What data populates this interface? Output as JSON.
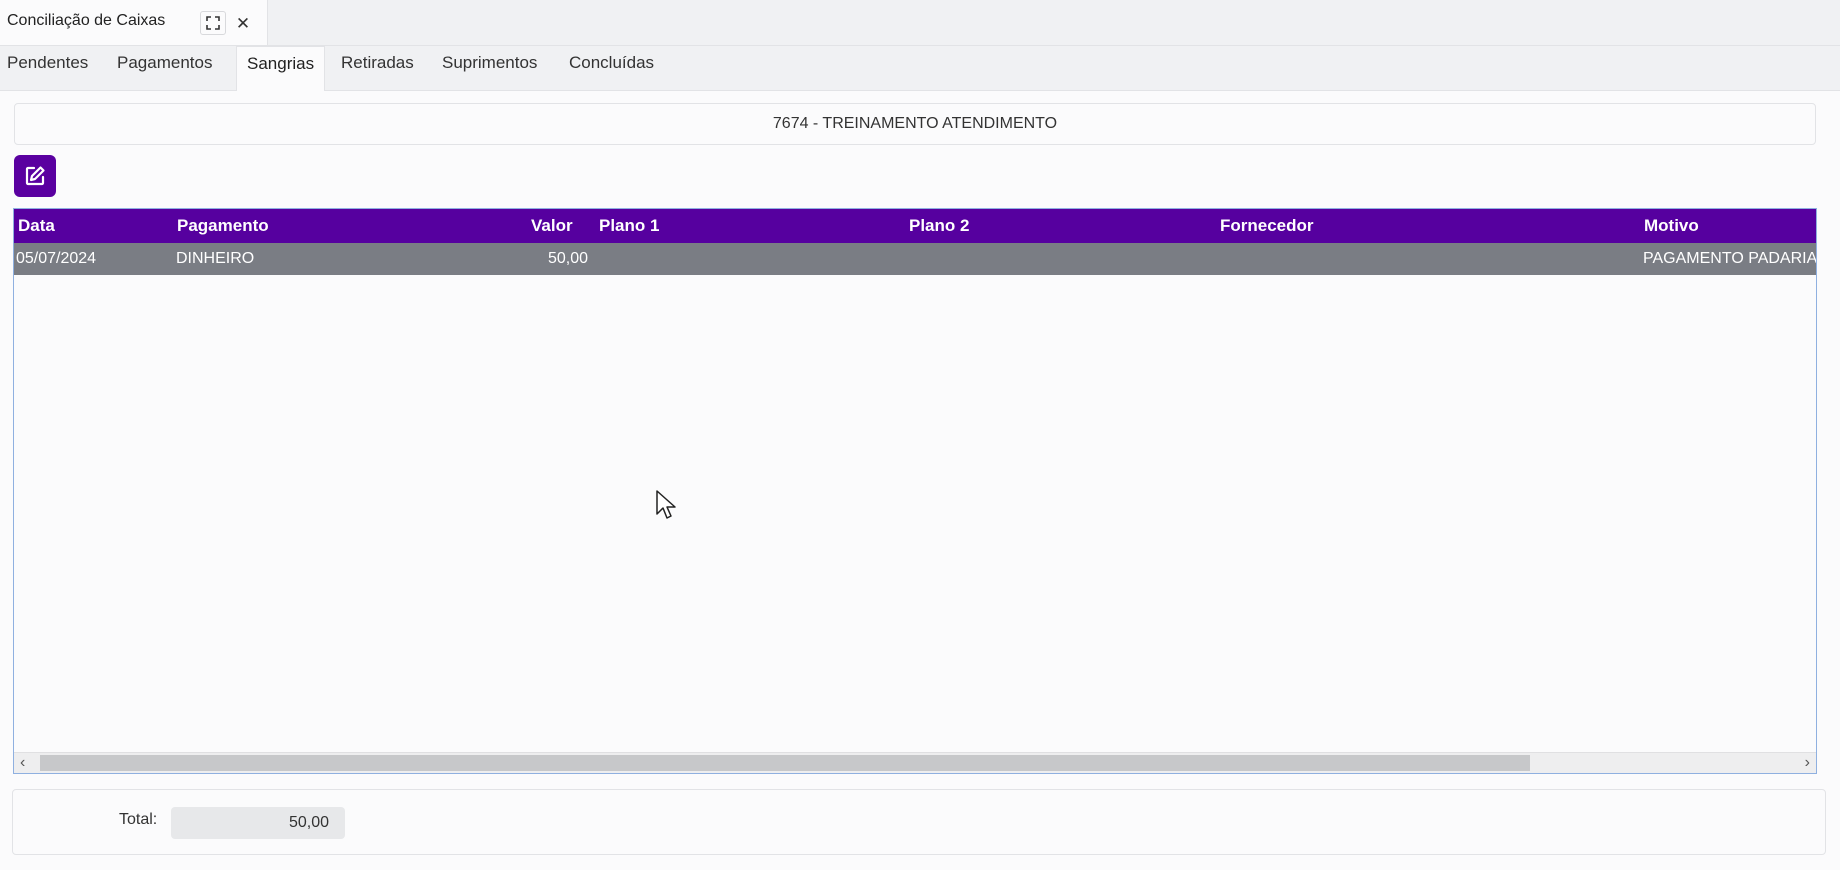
{
  "window": {
    "title": "Conciliação de Caixas",
    "maximize_icon": "⛶",
    "close_icon": "✕"
  },
  "tabs": [
    {
      "label": "Pendentes"
    },
    {
      "label": "Pagamentos"
    },
    {
      "label": "Sangrias",
      "active": true
    },
    {
      "label": "Retiradas"
    },
    {
      "label": "Suprimentos"
    },
    {
      "label": "Concluídas"
    }
  ],
  "store": {
    "label": "7674 - TREINAMENTO ATENDIMENTO"
  },
  "grid": {
    "columns": [
      "Data",
      "Pagamento",
      "Valor",
      "Plano 1",
      "Plano 2",
      "Fornecedor",
      "Motivo"
    ],
    "rows": [
      {
        "data": "05/07/2024",
        "pagamento": "DINHEIRO",
        "valor": "50,00",
        "plano1": "",
        "plano2": "",
        "fornecedor": "",
        "motivo": "PAGAMENTO PADARIA"
      }
    ],
    "scroll_left": "‹",
    "scroll_right": "›"
  },
  "footer": {
    "total_label": "Total:",
    "total_value": "50,00"
  },
  "colors": {
    "accent": "#56009f",
    "selected_row": "#7a7d84"
  }
}
